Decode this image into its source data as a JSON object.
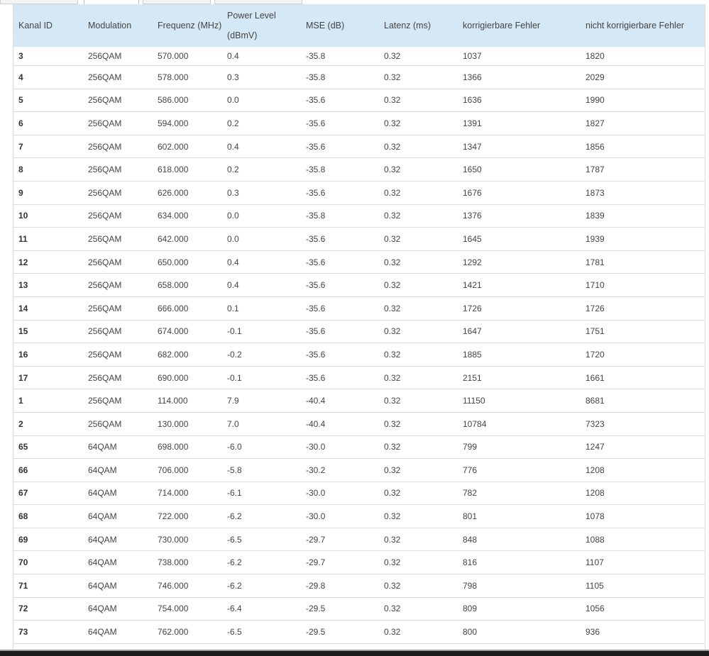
{
  "table": {
    "headers": [
      "Kanal ID",
      "Modulation",
      "Frequenz (MHz)",
      "Power Level (dBmV)",
      "MSE (dB)",
      "Latenz (ms)",
      "korrigierbare Fehler",
      "nicht korrigierbare Fehler"
    ],
    "power_header": {
      "line1": "Power Level",
      "line2": "(dBmV)"
    },
    "rows": [
      [
        "3",
        "256QAM",
        "570.000",
        "0.4",
        "-35.8",
        "0.32",
        "1037",
        "1820"
      ],
      [
        "4",
        "256QAM",
        "578.000",
        "0.3",
        "-35.8",
        "0.32",
        "1366",
        "2029"
      ],
      [
        "5",
        "256QAM",
        "586.000",
        "0.0",
        "-35.6",
        "0.32",
        "1636",
        "1990"
      ],
      [
        "6",
        "256QAM",
        "594.000",
        "0.2",
        "-35.6",
        "0.32",
        "1391",
        "1827"
      ],
      [
        "7",
        "256QAM",
        "602.000",
        "0.4",
        "-35.6",
        "0.32",
        "1347",
        "1856"
      ],
      [
        "8",
        "256QAM",
        "618.000",
        "0.2",
        "-35.8",
        "0.32",
        "1650",
        "1787"
      ],
      [
        "9",
        "256QAM",
        "626.000",
        "0.3",
        "-35.6",
        "0.32",
        "1676",
        "1873"
      ],
      [
        "10",
        "256QAM",
        "634.000",
        "0.0",
        "-35.8",
        "0.32",
        "1376",
        "1839"
      ],
      [
        "11",
        "256QAM",
        "642.000",
        "0.0",
        "-35.6",
        "0.32",
        "1645",
        "1939"
      ],
      [
        "12",
        "256QAM",
        "650.000",
        "0.4",
        "-35.6",
        "0.32",
        "1292",
        "1781"
      ],
      [
        "13",
        "256QAM",
        "658.000",
        "0.4",
        "-35.6",
        "0.32",
        "1421",
        "1710"
      ],
      [
        "14",
        "256QAM",
        "666.000",
        "0.1",
        "-35.6",
        "0.32",
        "1726",
        "1726"
      ],
      [
        "15",
        "256QAM",
        "674.000",
        "-0.1",
        "-35.6",
        "0.32",
        "1647",
        "1751"
      ],
      [
        "16",
        "256QAM",
        "682.000",
        "-0.2",
        "-35.6",
        "0.32",
        "1885",
        "1720"
      ],
      [
        "17",
        "256QAM",
        "690.000",
        "-0.1",
        "-35.6",
        "0.32",
        "2151",
        "1661"
      ],
      [
        "1",
        "256QAM",
        "114.000",
        "7.9",
        "-40.4",
        "0.32",
        "11150",
        "8681"
      ],
      [
        "2",
        "256QAM",
        "130.000",
        "7.0",
        "-40.4",
        "0.32",
        "10784",
        "7323"
      ],
      [
        "65",
        "64QAM",
        "698.000",
        "-6.0",
        "-30.0",
        "0.32",
        "799",
        "1247"
      ],
      [
        "66",
        "64QAM",
        "706.000",
        "-5.8",
        "-30.2",
        "0.32",
        "776",
        "1208"
      ],
      [
        "67",
        "64QAM",
        "714.000",
        "-6.1",
        "-30.0",
        "0.32",
        "782",
        "1208"
      ],
      [
        "68",
        "64QAM",
        "722.000",
        "-6.2",
        "-30.0",
        "0.32",
        "801",
        "1078"
      ],
      [
        "69",
        "64QAM",
        "730.000",
        "-6.5",
        "-29.7",
        "0.32",
        "848",
        "1088"
      ],
      [
        "70",
        "64QAM",
        "738.000",
        "-6.2",
        "-29.7",
        "0.32",
        "816",
        "1107"
      ],
      [
        "71",
        "64QAM",
        "746.000",
        "-6.2",
        "-29.8",
        "0.32",
        "798",
        "1105"
      ],
      [
        "72",
        "64QAM",
        "754.000",
        "-6.4",
        "-29.5",
        "0.32",
        "809",
        "1056"
      ],
      [
        "73",
        "64QAM",
        "762.000",
        "-6.5",
        "-29.5",
        "0.32",
        "800",
        "936"
      ]
    ]
  }
}
